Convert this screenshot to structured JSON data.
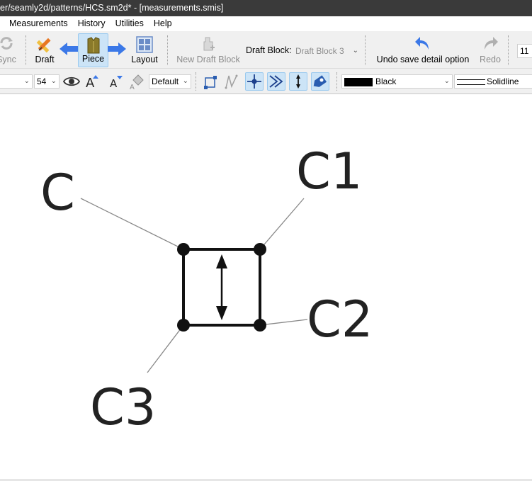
{
  "window": {
    "title": "er/seamly2d/patterns/HCS.sm2d* - [measurements.smis]"
  },
  "menu": {
    "items": [
      "Measurements",
      "History",
      "Utilities",
      "Help"
    ]
  },
  "toolbar": {
    "sync_label": "Sync",
    "draft_label": "Draft",
    "piece_label": "Piece",
    "layout_label": "Layout",
    "new_draft_block_label": "New Draft Block",
    "draft_block_label": "Draft Block:",
    "draft_block_value": "Draft Block 3",
    "undo_label": "Undo save detail option",
    "redo_label": "Redo",
    "zoom_value": "11"
  },
  "toolbar2": {
    "font_value": "",
    "font_size_value": "54",
    "text_style_value": "Default",
    "color_value": "Black",
    "line_style_value": "Solidline"
  },
  "canvas": {
    "labels": [
      "C",
      "C1",
      "C2",
      "C3"
    ]
  },
  "colors": {
    "accent_blue": "#3b78e7",
    "active_bg": "#cce4f7",
    "title_bg": "#3a3a3a"
  }
}
